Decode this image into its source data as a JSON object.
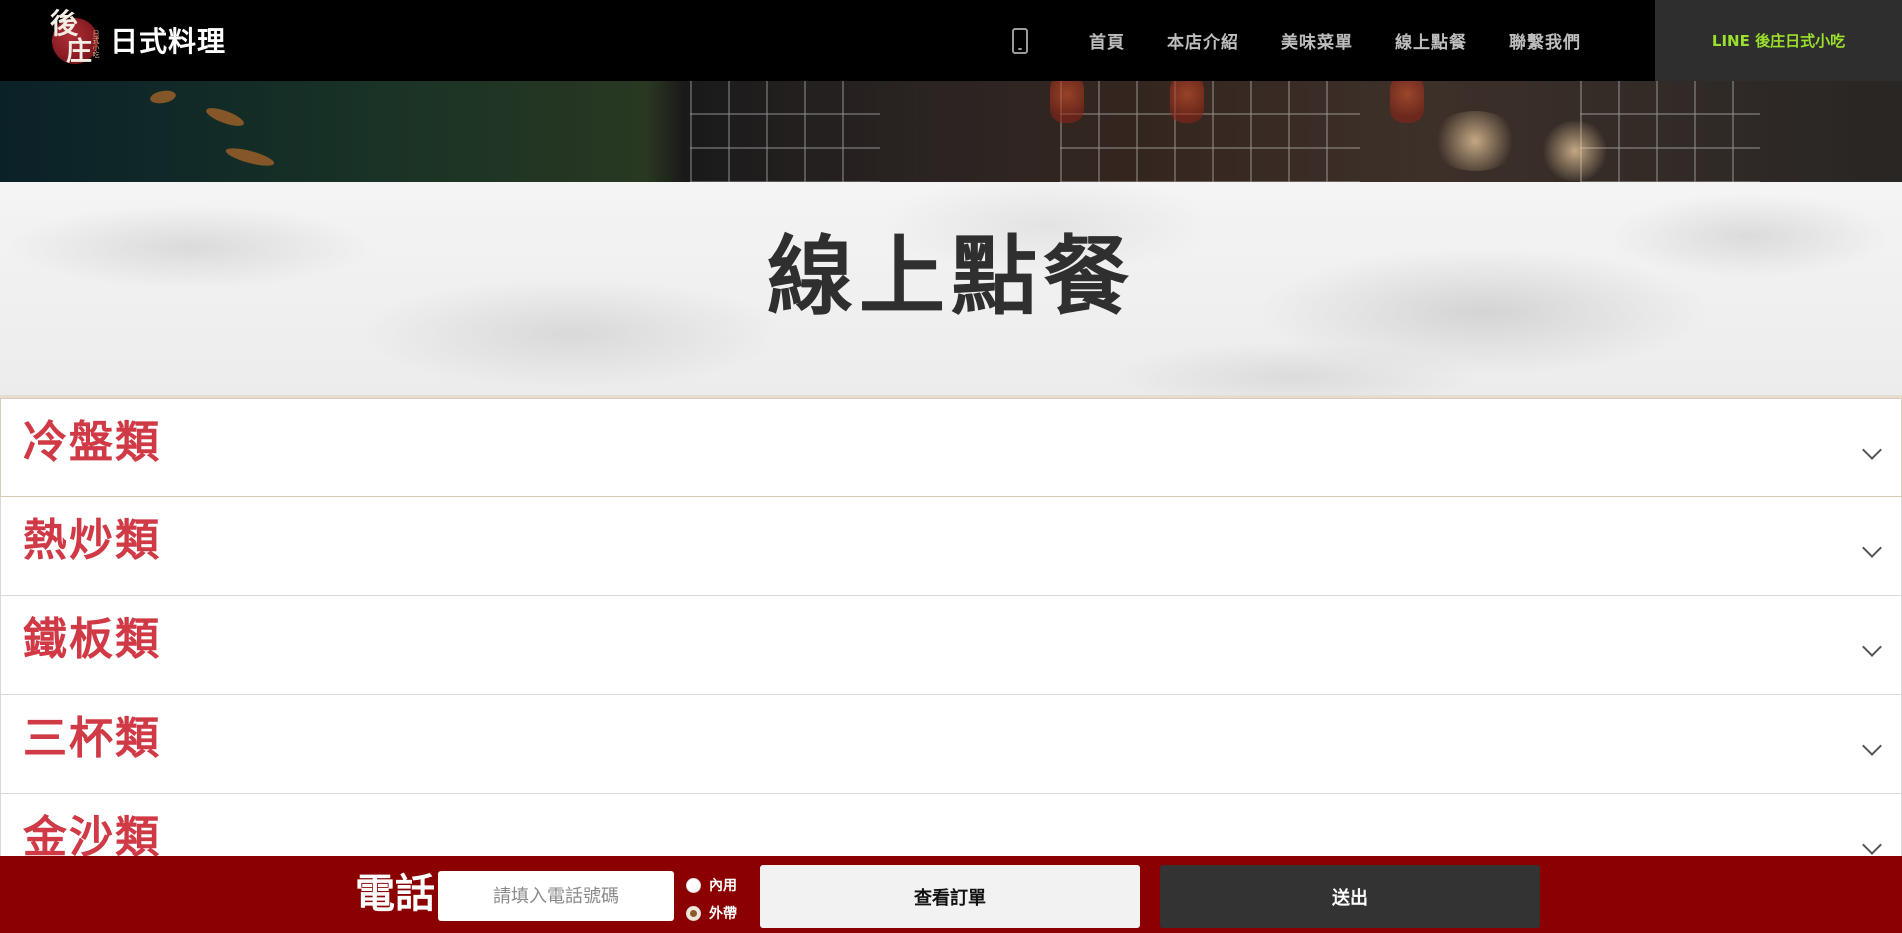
{
  "header": {
    "logo_glyph_top": "後",
    "logo_glyph_bottom": "庄",
    "logo_small_text": "日式小吃",
    "logo_text": "日式料理",
    "phone_icon": "mobile-phone-icon",
    "nav": [
      {
        "label": "首頁"
      },
      {
        "label": "本店介紹"
      },
      {
        "label": "美味菜單"
      },
      {
        "label": "線上點餐"
      },
      {
        "label": "聯繫我們"
      }
    ],
    "line_button": "LINE 後庄日式小吃"
  },
  "page": {
    "title": "線上點餐"
  },
  "categories": [
    {
      "label": "冷盤類"
    },
    {
      "label": "熱炒類"
    },
    {
      "label": "鐵板類"
    },
    {
      "label": "三杯類"
    },
    {
      "label": "金沙類"
    }
  ],
  "order_bar": {
    "phone_label": "電話",
    "phone_placeholder": "請填入電話號碼",
    "phone_value": "",
    "options": [
      {
        "label": "內用",
        "checked": false
      },
      {
        "label": "外帶",
        "checked": true
      }
    ],
    "view_order_button": "查看訂單",
    "submit_button": "送出"
  },
  "colors": {
    "nav_bg": "#000000",
    "accent_red": "#d03a46",
    "order_bar_bg": "#8b0000",
    "line_green": "#9be02a"
  }
}
